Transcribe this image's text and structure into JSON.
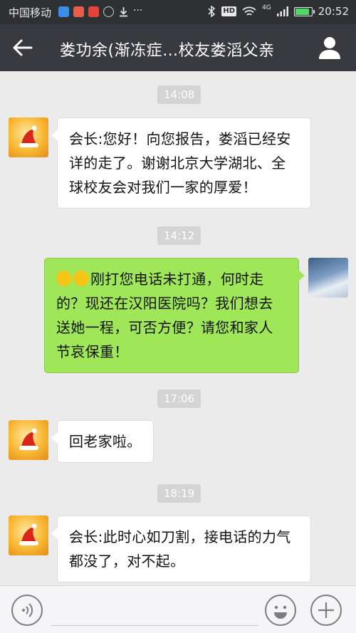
{
  "status_bar": {
    "carrier": "中国移动",
    "time": "20:52",
    "network_label": "4G",
    "hd_label": "HD",
    "battery_level": 0.8
  },
  "header": {
    "title": "娄功余(渐冻症…校友娄滔父亲",
    "back_icon": "arrow-left-icon",
    "profile_icon": "person-icon"
  },
  "messages": [
    {
      "kind": "time",
      "text": "14:08"
    },
    {
      "kind": "message",
      "side": "left",
      "text": "会长:您好！向您报告，娄滔已经安详的走了。谢谢北京大学湖北、全球校友会对我们一家的厚爱！"
    },
    {
      "kind": "time",
      "text": "14:12"
    },
    {
      "kind": "message",
      "side": "right",
      "emoji": "crying-face-icon",
      "text": "刚打您电话未打通，何时走的？现还在汉阳医院吗？我们想去送她一程，可否方便？请您和家人节哀保重！"
    },
    {
      "kind": "time",
      "text": "17:06"
    },
    {
      "kind": "message",
      "side": "left",
      "text": "回老家啦。"
    },
    {
      "kind": "time",
      "text": "18:19"
    },
    {
      "kind": "message",
      "side": "left",
      "text": "会长:此时心如刀割，接电话的力气都没了，对不起。"
    }
  ],
  "input_bar": {
    "voice_icon": "voice-icon",
    "emoji_icon": "smiley-icon",
    "plus_icon": "plus-icon"
  },
  "colors": {
    "statusbar_bg": "#2e3033",
    "titlebar_bg": "#393a3f",
    "chat_bg": "#ebebeb",
    "sent_bubble": "#9fe658",
    "received_bubble": "#ffffff"
  }
}
